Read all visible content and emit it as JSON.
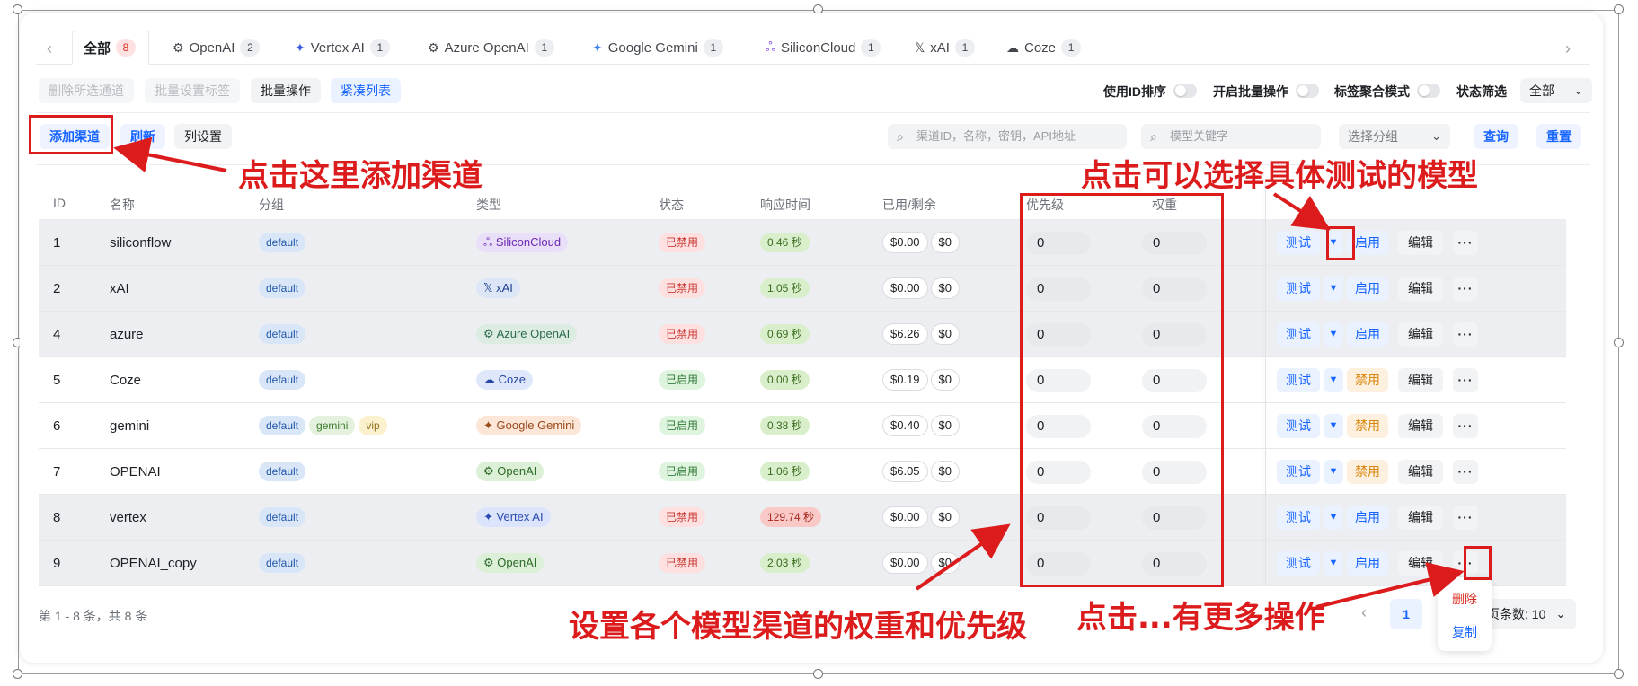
{
  "tabs": {
    "items": [
      {
        "label": "全部",
        "count": "8",
        "icon": ""
      },
      {
        "label": "OpenAI",
        "count": "2",
        "icon": "openai-icon"
      },
      {
        "label": "Vertex AI",
        "count": "1",
        "icon": "vertex-icon"
      },
      {
        "label": "Azure OpenAI",
        "count": "1",
        "icon": "azure-openai-icon"
      },
      {
        "label": "Google Gemini",
        "count": "1",
        "icon": "gemini-icon"
      },
      {
        "label": "SiliconCloud",
        "count": "1",
        "icon": "siliconcloud-icon"
      },
      {
        "label": "xAI",
        "count": "1",
        "icon": "xai-icon"
      },
      {
        "label": "Coze",
        "count": "1",
        "icon": "coze-icon"
      }
    ]
  },
  "toolbar": {
    "delete_selected": "删除所选通道",
    "batch_tag": "批量设置标签",
    "batch_ops": "批量操作",
    "compact_list": "紧凑列表",
    "use_id_sort": "使用ID排序",
    "enable_batch": "开启批量操作",
    "tag_aggregate": "标签聚合模式",
    "status_filter": "状态筛选",
    "status_value": "全部",
    "add_channel": "添加渠道",
    "refresh": "刷新",
    "column_settings": "列设置",
    "search_placeholder": "渠道ID，名称，密钥，API地址",
    "model_placeholder": "模型关键字",
    "group_placeholder": "选择分组",
    "query": "查询",
    "reset": "重置"
  },
  "table": {
    "headers": {
      "id": "ID",
      "name": "名称",
      "group": "分组",
      "type": "类型",
      "status": "状态",
      "response": "响应时间",
      "balance": "已用/剩余",
      "priority": "优先级",
      "weight": "权重"
    },
    "rows": [
      {
        "id": "1",
        "name": "siliconflow",
        "groups": [
          "default"
        ],
        "type": "SiliconCloud",
        "type_icon": "siliconcloud-icon",
        "status": "已禁用",
        "response": "0.46 秒",
        "used": "$0.00",
        "remain": "$0",
        "priority": "0",
        "weight": "0",
        "toggle": "启用"
      },
      {
        "id": "2",
        "name": "xAI",
        "groups": [
          "default"
        ],
        "type": "xAI",
        "type_icon": "xai-icon",
        "status": "已禁用",
        "response": "1.05 秒",
        "used": "$0.00",
        "remain": "$0",
        "priority": "0",
        "weight": "0",
        "toggle": "启用"
      },
      {
        "id": "4",
        "name": "azure",
        "groups": [
          "default"
        ],
        "type": "Azure OpenAI",
        "type_icon": "azure-openai-icon",
        "status": "已禁用",
        "response": "0.69 秒",
        "used": "$6.26",
        "remain": "$0",
        "priority": "0",
        "weight": "0",
        "toggle": "启用"
      },
      {
        "id": "5",
        "name": "Coze",
        "groups": [
          "default"
        ],
        "type": "Coze",
        "type_icon": "coze-icon",
        "status": "已启用",
        "response": "0.00 秒",
        "used": "$0.19",
        "remain": "$0",
        "priority": "0",
        "weight": "0",
        "toggle": "禁用"
      },
      {
        "id": "6",
        "name": "gemini",
        "groups": [
          "default",
          "gemini",
          "vip"
        ],
        "type": "Google Gemini",
        "type_icon": "gemini-icon",
        "status": "已启用",
        "response": "0.38 秒",
        "used": "$0.40",
        "remain": "$0",
        "priority": "0",
        "weight": "0",
        "toggle": "禁用"
      },
      {
        "id": "7",
        "name": "OPENAI",
        "groups": [
          "default"
        ],
        "type": "OpenAI",
        "type_icon": "openai-icon",
        "status": "已启用",
        "response": "1.06 秒",
        "used": "$6.05",
        "remain": "$0",
        "priority": "0",
        "weight": "0",
        "toggle": "禁用"
      },
      {
        "id": "8",
        "name": "vertex",
        "groups": [
          "default"
        ],
        "type": "Vertex AI",
        "type_icon": "vertex-icon",
        "status": "已禁用",
        "response": "129.74 秒",
        "used": "$0.00",
        "remain": "$0",
        "priority": "0",
        "weight": "0",
        "toggle": "启用"
      },
      {
        "id": "9",
        "name": "OPENAI_copy",
        "groups": [
          "default"
        ],
        "type": "OpenAI",
        "type_icon": "openai-icon",
        "status": "已禁用",
        "response": "2.03 秒",
        "used": "$0.00",
        "remain": "$0",
        "priority": "0",
        "weight": "0",
        "toggle": "启用"
      }
    ],
    "actions": {
      "test": "测试",
      "edit": "编辑",
      "more": "···"
    }
  },
  "footer": {
    "summary": "第 1 - 8 条，共 8 条",
    "page": "1",
    "page_size_label": "页条数: 10"
  },
  "popup": {
    "delete": "删除",
    "copy": "复制"
  },
  "annotations": {
    "add_channel": "点击这里添加渠道",
    "select_model": "点击可以选择具体测试的模型",
    "weight_priority": "设置各个模型渠道的权重和优先级",
    "more_ops": "点击...有更多操作"
  },
  "colors": {
    "accent": "#1664ff",
    "annotation_red": "#dc1c1c",
    "disabled_red": "#c93a33",
    "enabled_green": "#2f7a35"
  }
}
